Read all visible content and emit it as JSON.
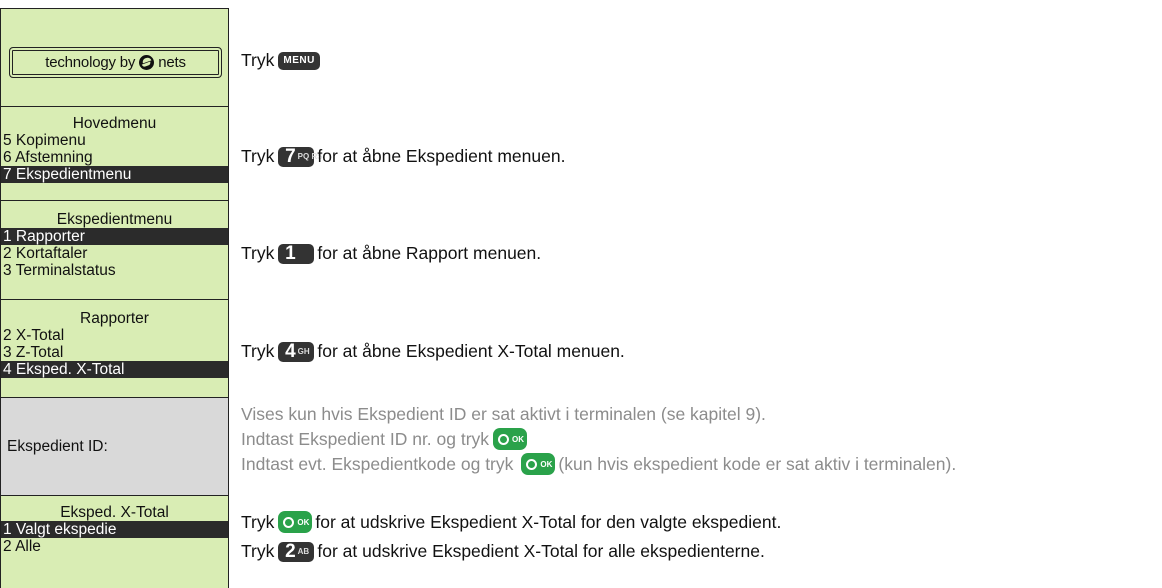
{
  "screens": {
    "logo": {
      "text_a": "technology by",
      "text_b": "nets"
    },
    "hovedmenu": {
      "title": "Hovedmenu",
      "lines": [
        "5 Kopimenu",
        "6 Afstemning",
        "7 Ekspedientmenu"
      ]
    },
    "ekspedientmenu": {
      "title": "Ekspedientmenu",
      "lines": [
        "1 Rapporter",
        "2 Kortaftaler",
        "3 Terminalstatus"
      ]
    },
    "rapporter": {
      "title": "Rapporter",
      "lines": [
        "2 X-Total",
        "3 Z-Total",
        "4 Eksped. X-Total"
      ]
    },
    "ekspedient_id": {
      "label": "Ekspedient ID:"
    },
    "eksped_xtotal": {
      "title": "Eksped. X-Total",
      "lines": [
        "1 Valgt ekspedie",
        "2 Alle"
      ]
    }
  },
  "instructions": {
    "step1": {
      "prefix": "Tryk",
      "key": "MENU",
      "suffix": ""
    },
    "step2": {
      "prefix": "Tryk",
      "key": "7",
      "key_sub": "PQ RS",
      "suffix": "for at åbne Ekspedient menuen."
    },
    "step3": {
      "prefix": "Tryk",
      "key": "1",
      "suffix": "for at åbne Rapport menuen."
    },
    "step4": {
      "prefix": "Tryk",
      "key": "4",
      "key_sub": "GH",
      "suffix": "for at åbne Ekspedient X-Total menuen."
    },
    "step5": {
      "line1": "Vises kun hvis Ekspedient ID er sat aktivt i terminalen (se kapitel 9).",
      "line2": "Indtast Ekspedient ID nr. og tryk",
      "line3a": "Indtast evt. Ekspedientkode og tryk",
      "line3b": "(kun hvis ekspedient kode er sat aktiv i terminalen).",
      "ok_key": "OK"
    },
    "step6": {
      "prefix": "Tryk",
      "ok_key": "OK",
      "suffix": "for at udskrive Ekspedient X-Total for den valgte ekspedient."
    },
    "step7": {
      "prefix": "Tryk",
      "key": "2",
      "key_sub": "AB",
      "suffix": "for at udskrive Ekspedient X-Total for alle ekspedienterne."
    }
  },
  "colors": {
    "screen_bg": "#d9edb4",
    "screen_gray": "#d9d9d9",
    "selected_bg": "#2b2b2b",
    "ok_green": "#2aa24a",
    "key_dark": "#333333",
    "note_gray": "#8c8c8c"
  }
}
